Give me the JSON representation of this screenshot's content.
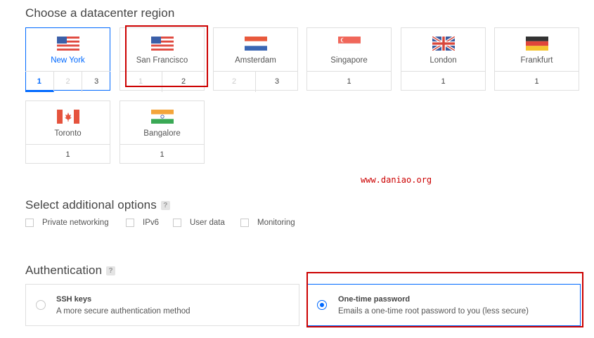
{
  "datacenter": {
    "title": "Choose a datacenter region",
    "regions": [
      {
        "name": "New York",
        "numbers": [
          "1",
          "2",
          "3"
        ]
      },
      {
        "name": "San Francisco",
        "numbers": [
          "1",
          "2"
        ]
      },
      {
        "name": "Amsterdam",
        "numbers": [
          "2",
          "3"
        ]
      },
      {
        "name": "Singapore",
        "numbers": [
          "1"
        ]
      },
      {
        "name": "London",
        "numbers": [
          "1"
        ]
      },
      {
        "name": "Frankfurt",
        "numbers": [
          "1"
        ]
      },
      {
        "name": "Toronto",
        "numbers": [
          "1"
        ]
      },
      {
        "name": "Bangalore",
        "numbers": [
          "1"
        ]
      }
    ]
  },
  "watermark": "www.daniao.org",
  "options": {
    "title": "Select additional options",
    "help": "?",
    "items": [
      "Private networking",
      "IPv6",
      "User data",
      "Monitoring"
    ]
  },
  "auth": {
    "title": "Authentication",
    "help": "?",
    "ssh_title": "SSH keys",
    "ssh_desc": "A more secure authentication method",
    "otp_title": "One-time password",
    "otp_desc": "Emails a one-time root password to you (less secure)"
  },
  "colors": {
    "accent": "#0069ff",
    "annotation": "#cc0000"
  }
}
